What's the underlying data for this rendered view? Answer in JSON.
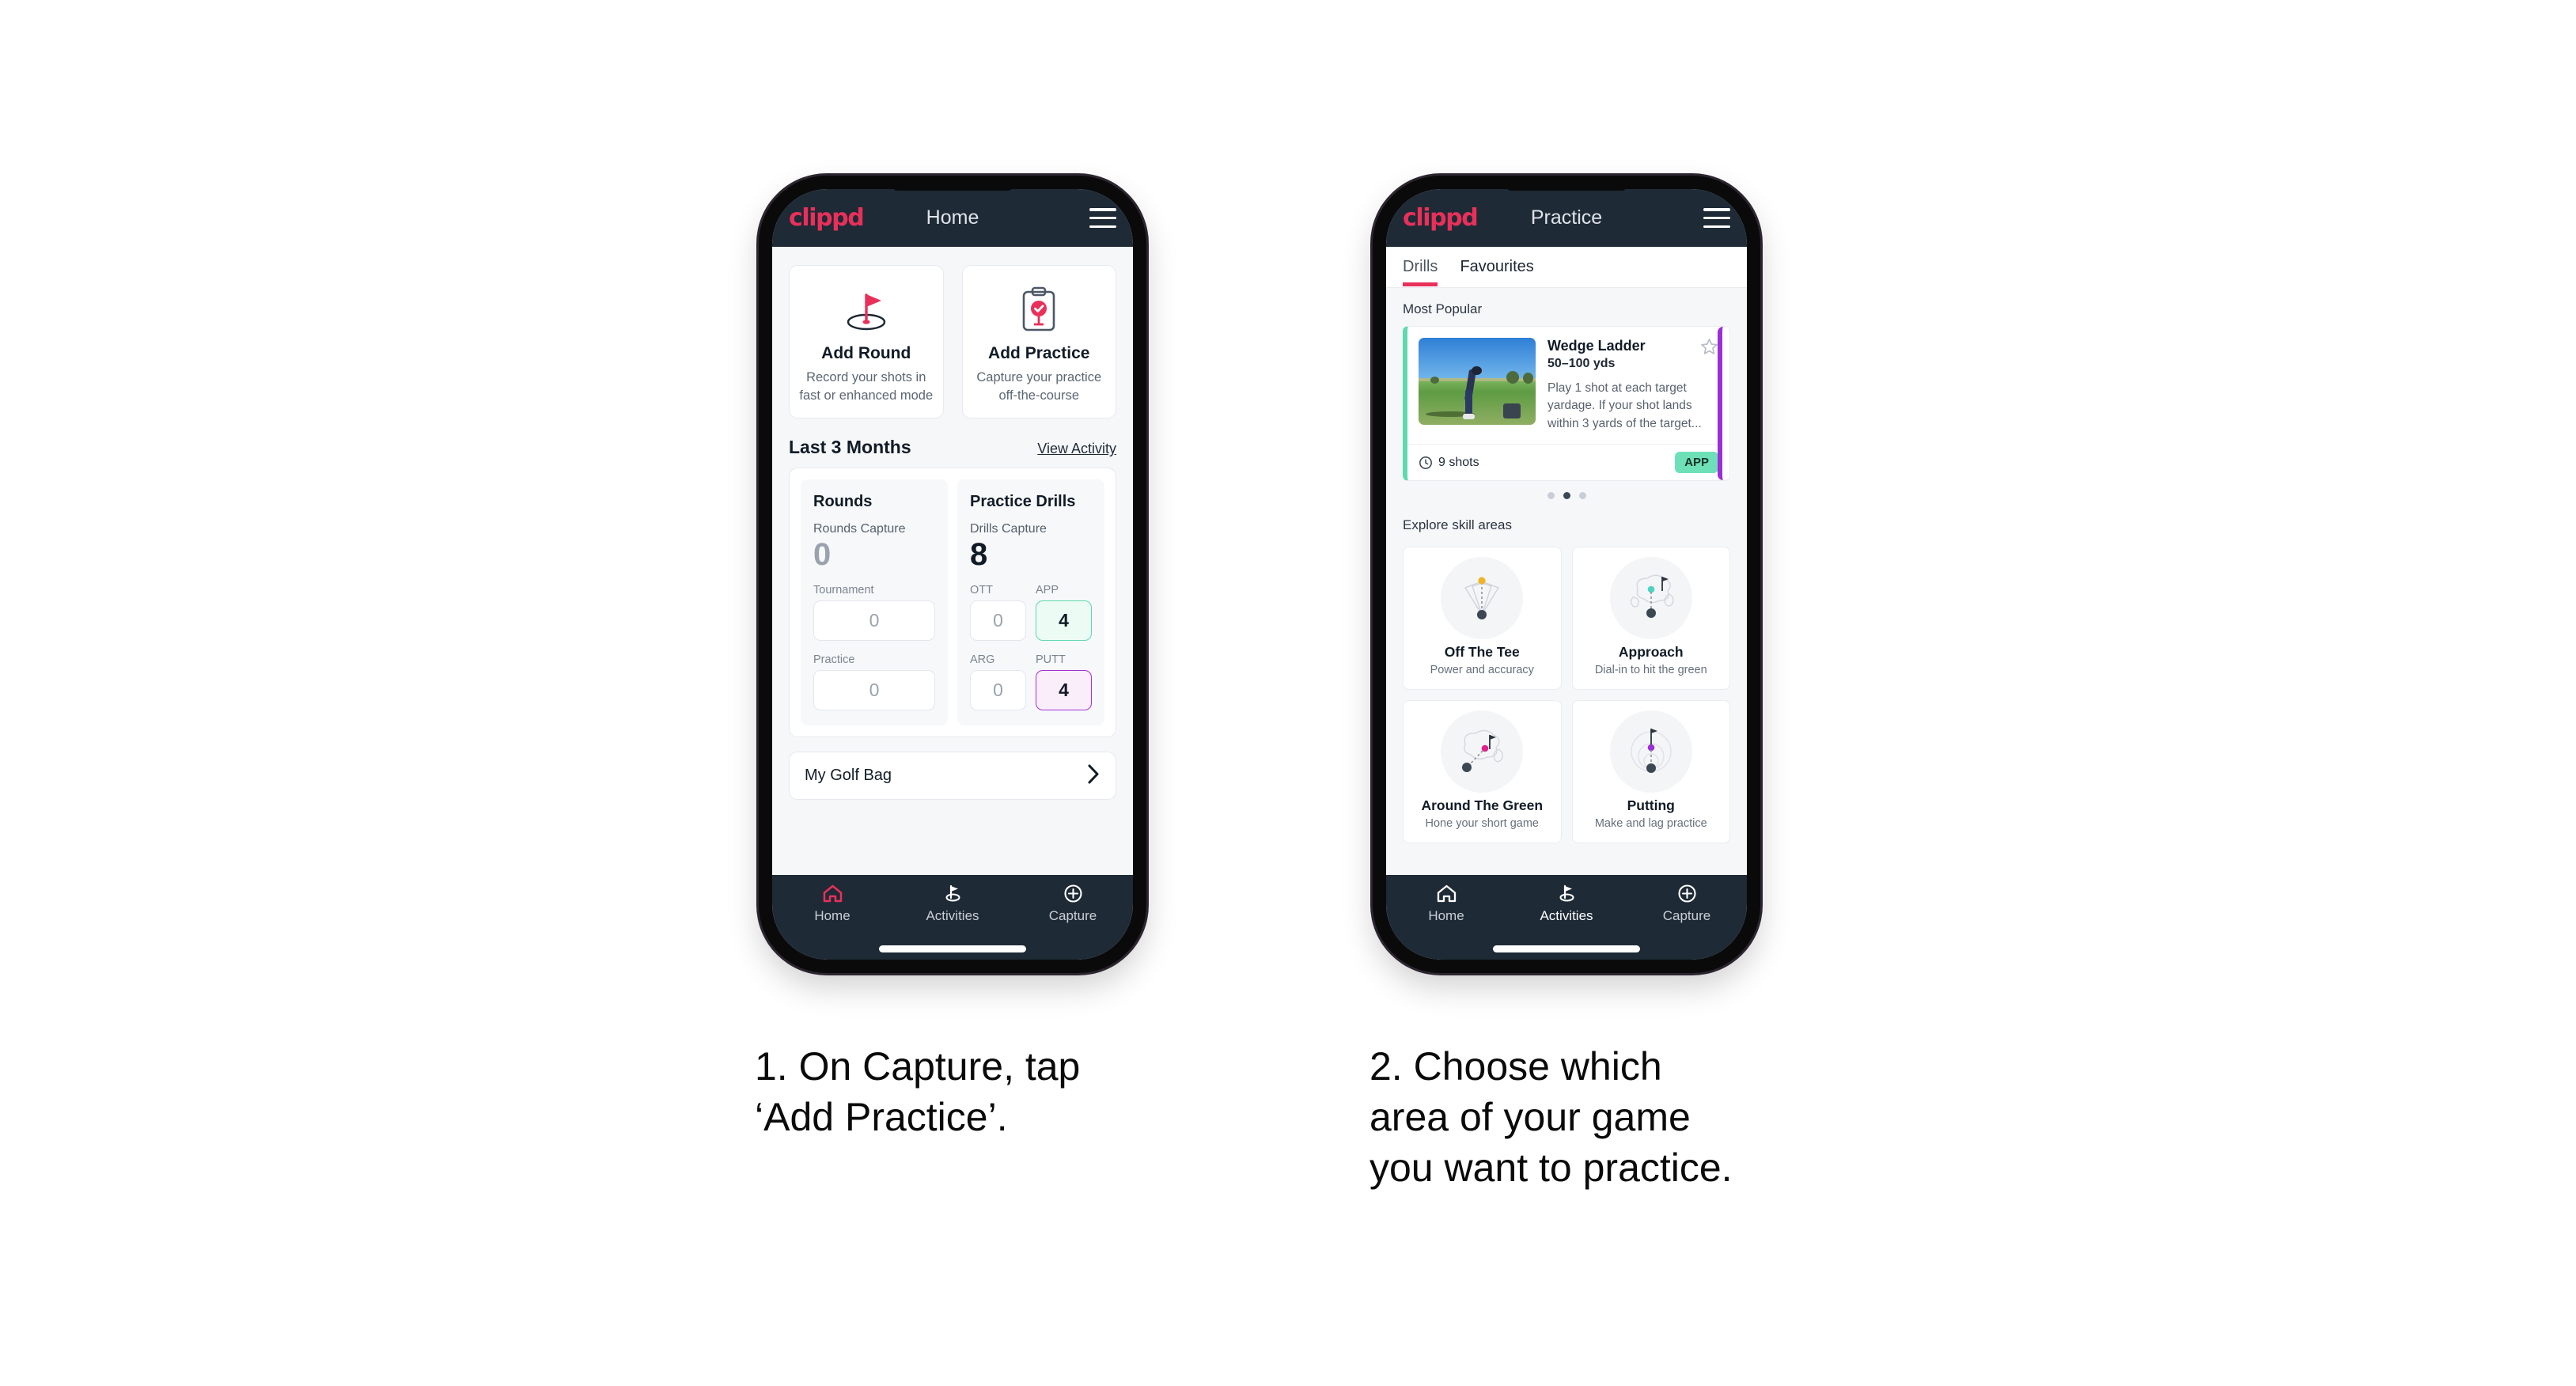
{
  "brand": "clippd",
  "phone1": {
    "header": {
      "title": "Home",
      "menu_icon": "hamburger-icon"
    },
    "quick_actions": [
      {
        "icon": "golf-flag-hole-icon",
        "title": "Add Round",
        "subtitle": "Record your shots in fast or enhanced mode"
      },
      {
        "icon": "clipboard-check-icon",
        "title": "Add Practice",
        "subtitle": "Capture your practice off-the-course"
      }
    ],
    "section": {
      "title": "Last 3 Months",
      "link": "View Activity"
    },
    "stats": {
      "rounds": {
        "heading": "Rounds",
        "capture_label": "Rounds Capture",
        "capture_value": "0",
        "items": [
          {
            "label": "Tournament",
            "value": "0",
            "state": "empty"
          },
          {
            "label": "Practice",
            "value": "0",
            "state": "empty"
          }
        ]
      },
      "drills": {
        "heading": "Practice Drills",
        "capture_label": "Drills Capture",
        "capture_value": "8",
        "items": [
          {
            "label": "OTT",
            "value": "0",
            "state": "empty"
          },
          {
            "label": "APP",
            "value": "4",
            "state": "green"
          },
          {
            "label": "ARG",
            "value": "0",
            "state": "empty"
          },
          {
            "label": "PUTT",
            "value": "4",
            "state": "purple"
          }
        ]
      }
    },
    "golf_bag": {
      "label": "My Golf Bag",
      "chevron": "chevron-right-icon"
    },
    "bottom_nav": [
      {
        "icon": "home-icon",
        "label": "Home",
        "active": true
      },
      {
        "icon": "golf-flag-icon",
        "label": "Activities",
        "active": false
      },
      {
        "icon": "plus-circle-icon",
        "label": "Capture",
        "active": false
      }
    ]
  },
  "phone2": {
    "header": {
      "title": "Practice",
      "menu_icon": "hamburger-icon"
    },
    "tabs": [
      {
        "label": "Drills",
        "active": true
      },
      {
        "label": "Favourites",
        "active": false
      }
    ],
    "most_popular_label": "Most Popular",
    "drill": {
      "title": "Wedge Ladder",
      "yardage": "50–100 yds",
      "description": "Play 1 shot at each target yardage. If your shot lands within 3 yards of the target...",
      "shots": "9 shots",
      "shots_icon": "clock-icon",
      "badge": "APP",
      "favourite_icon": "star-outline-icon",
      "thumbnail": "golfer-practice-photo"
    },
    "carousel_dots": {
      "count": 3,
      "active_index": 1
    },
    "explore_label": "Explore skill areas",
    "skill_areas": [
      {
        "title": "Off The Tee",
        "subtitle": "Power and accuracy",
        "icon": "tee-shot-dispersion-icon",
        "accent": "#f0b429"
      },
      {
        "title": "Approach",
        "subtitle": "Dial-in to hit the green",
        "icon": "approach-green-icon",
        "accent": "#4cd4c0"
      },
      {
        "title": "Around The Green",
        "subtitle": "Hone your short game",
        "icon": "chip-green-icon",
        "accent": "#e0218a"
      },
      {
        "title": "Putting",
        "subtitle": "Make and lag practice",
        "icon": "putting-rings-icon",
        "accent": "#9b2fd8"
      }
    ],
    "bottom_nav": [
      {
        "icon": "home-icon",
        "label": "Home",
        "active": false
      },
      {
        "icon": "golf-flag-icon",
        "label": "Activities",
        "active": true
      },
      {
        "icon": "plus-circle-icon",
        "label": "Capture",
        "active": false
      }
    ]
  },
  "captions": {
    "step1": "1. On Capture, tap\n‘Add Practice’.",
    "step2": "2. Choose which\narea of your game\nyou want to practice."
  },
  "colors": {
    "brand_pink": "#e8305a",
    "header_dark": "#1e2a36",
    "accent_green": "#5fd9ae",
    "accent_purple": "#a630d8",
    "badge_green": "#6ee0b8"
  }
}
